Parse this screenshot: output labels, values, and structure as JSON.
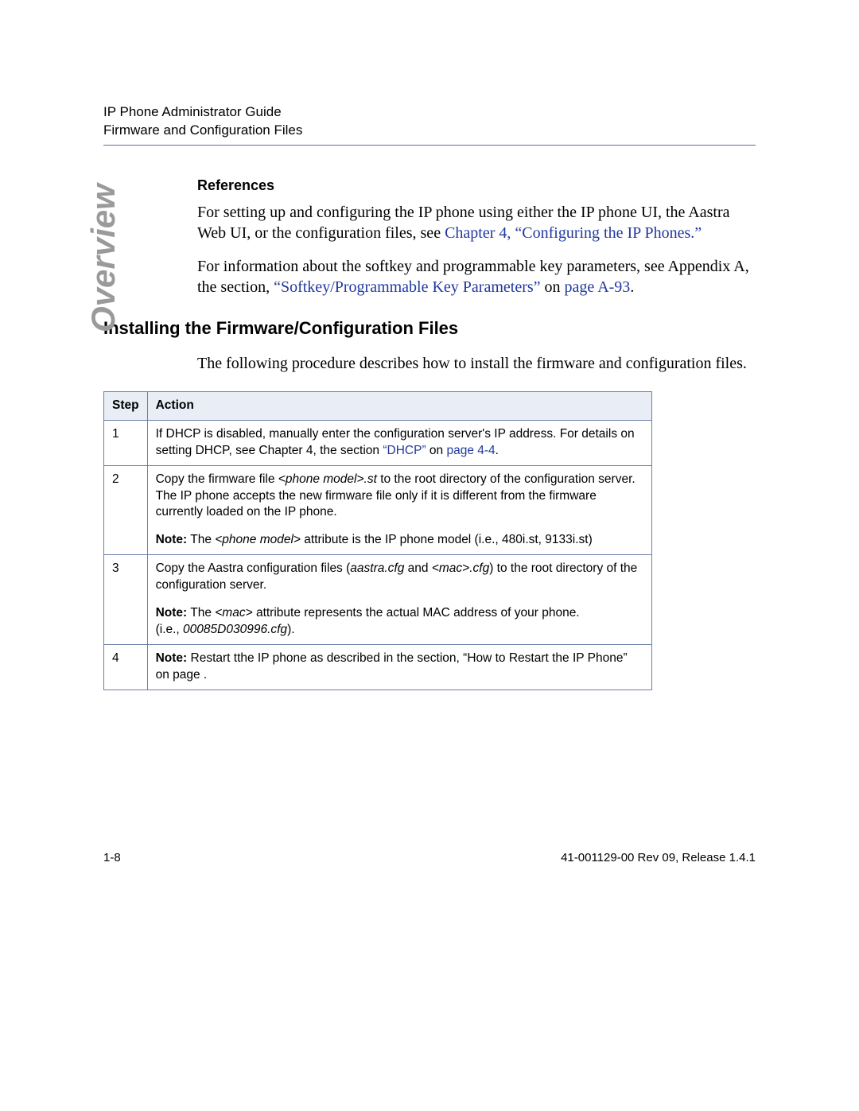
{
  "header": {
    "line1": "IP Phone Administrator Guide",
    "line2": "Firmware and Configuration Files"
  },
  "sideLabel": "Overview",
  "references": {
    "heading": "References",
    "p1a": "For setting up and configuring the IP phone using either the IP phone UI, the Aastra Web UI, or the configuration files, see ",
    "p1link": "Chapter 4, “Configuring the IP Phones.”",
    "p2a": "For information about the softkey and programmable key parameters, see Appendix A, the section, ",
    "p2link1": "“Softkey/Programmable Key Parameters”",
    "p2b": " on ",
    "p2link2": "page A-93",
    "p2c": "."
  },
  "section": {
    "heading": "Installing the Firmware/Configuration Files",
    "intro": "The following procedure describes how to install the firmware and configuration files."
  },
  "table": {
    "h1": "Step",
    "h2": "Action",
    "rows": [
      {
        "step": "1",
        "a": "If DHCP is disabled, manually enter the configuration server's IP address. For details on setting DHCP, see Chapter 4, the section ",
        "l1": "“DHCP”",
        "b": " on ",
        "l2": "page 4-4",
        "c": "."
      },
      {
        "step": "2",
        "a1": "Copy the firmware file ",
        "i1": "<phone model>.st",
        "a2": " to the root directory of the configuration server. The IP phone accepts the new firmware file only if it is different from the firmware currently loaded on the IP phone.",
        "noteLabel": "Note:",
        "n1": " The ",
        "ni1": "<phone model>",
        "n2": " attribute is the IP phone model (i.e., 480i.st, 9133i.st)"
      },
      {
        "step": "3",
        "a1": "Copy the Aastra configuration files (",
        "i1": "aastra.cfg",
        "a2": " and ",
        "i2": "<mac>.cfg",
        "a3": ") to the root directory of the configuration server.",
        "noteLabel": "Note:",
        "n1": " The ",
        "ni1": "<mac>",
        "n2": " attribute represents the actual MAC address of your phone.",
        "n3a": "(i.e., ",
        "n3i": "00085D030996.cfg",
        "n3b": ")."
      },
      {
        "step": "4",
        "noteLabel": "Note:",
        "n1": " Restart tthe IP phone as described in the section, “How to Restart the IP Phone” on page ."
      }
    ]
  },
  "footer": {
    "left": "1-8",
    "right": "41-001129-00 Rev 09, Release 1.4.1"
  }
}
